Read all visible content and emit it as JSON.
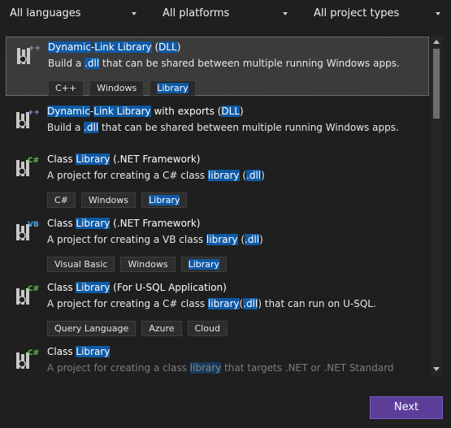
{
  "filters": {
    "language": "All languages",
    "platform": "All platforms",
    "project_type": "All project types"
  },
  "templates": [
    {
      "title": [
        "Dynamic",
        "-",
        "Link Library",
        " (",
        "DLL",
        ")"
      ],
      "desc": [
        "Build a ",
        ".dll",
        " that can be shared between multiple running Windows apps."
      ],
      "tags": [
        "C++",
        "Windows",
        "Library"
      ],
      "badge": "++"
    },
    {
      "title": [
        "Dynamic",
        "-",
        "Link Library",
        " with exports (",
        "DLL",
        ")"
      ],
      "desc": [
        "Build a ",
        ".dll",
        " that can be shared between multiple running Windows apps."
      ],
      "tags": [],
      "badge": "++"
    },
    {
      "title": [
        "Class ",
        "Library",
        " (.NET Framework)"
      ],
      "desc": [
        "A project for creating a C# class ",
        "library",
        " (",
        ".dll",
        ")"
      ],
      "tags": [
        "C#",
        "Windows",
        "Library"
      ],
      "badge": "C#"
    },
    {
      "title": [
        "Class ",
        "Library",
        " (.NET Framework)"
      ],
      "desc": [
        "A project for creating a VB class ",
        "library",
        " (",
        ".dll",
        ")"
      ],
      "tags": [
        "Visual Basic",
        "Windows",
        "Library"
      ],
      "badge": "VB"
    },
    {
      "title": [
        "Class ",
        "Library",
        " (For U-SQL Application)"
      ],
      "desc": [
        "A project for creating a C# class ",
        "library",
        "(",
        ".dll",
        ") that can run on U-SQL."
      ],
      "tags": [
        "Query Language",
        "Azure",
        "Cloud"
      ],
      "badge": "C#"
    },
    {
      "title": [
        "Class ",
        "Library"
      ],
      "desc": [
        "A project for creating a class ",
        "library",
        " that targets .NET or .NET Standard"
      ],
      "tags": [],
      "badge": "C#"
    }
  ],
  "buttons": {
    "next": "Next"
  }
}
